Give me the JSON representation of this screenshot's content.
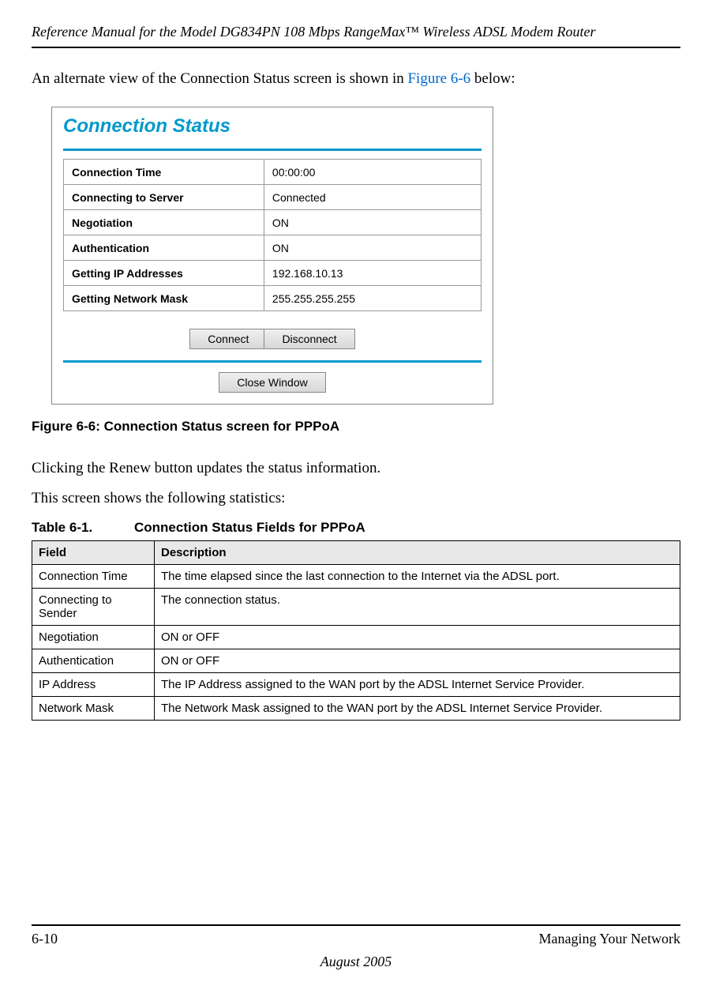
{
  "header": {
    "title": "Reference Manual for the Model DG834PN 108 Mbps RangeMax™ Wireless ADSL Modem Router"
  },
  "intro": {
    "pre": "An alternate view of the Connection Status screen is shown in ",
    "link": "Figure 6-6",
    "post": " below:"
  },
  "screenshot": {
    "title": "Connection Status",
    "rows": [
      {
        "label": "Connection Time",
        "value": "00:00:00"
      },
      {
        "label": "Connecting to Server",
        "value": "Connected"
      },
      {
        "label": "Negotiation",
        "value": "ON"
      },
      {
        "label": "Authentication",
        "value": "ON"
      },
      {
        "label": "Getting IP Addresses",
        "value": "192.168.10.13"
      },
      {
        "label": "Getting Network Mask",
        "value": "255.255.255.255"
      }
    ],
    "buttons": {
      "connect": "Connect",
      "disconnect": "Disconnect",
      "close": "Close Window"
    }
  },
  "figure_caption": "Figure 6-6:  Connection Status screen for PPPoA",
  "para1": "Clicking the Renew button updates the status information.",
  "para2": "This screen shows the following statistics:",
  "table_caption": {
    "num": "Table 6-1.",
    "title": "Connection Status Fields for PPPoA"
  },
  "desc_table": {
    "headers": {
      "field": "Field",
      "desc": "Description"
    },
    "rows": [
      {
        "field": "Connection Time",
        "desc": "The time elapsed since the last connection to the Internet via the ADSL port."
      },
      {
        "field": "Connecting to Sender",
        "desc": "The connection status."
      },
      {
        "field": "Negotiation",
        "desc": "ON or OFF"
      },
      {
        "field": "Authentication",
        "desc": "ON or OFF"
      },
      {
        "field": "IP Address",
        "desc": "The IP Address assigned to the WAN port by the ADSL Internet Service Provider."
      },
      {
        "field": "Network Mask",
        "desc": "The Network Mask assigned to the WAN port by the ADSL Internet Service Provider."
      }
    ]
  },
  "footer": {
    "left": "6-10",
    "right": "Managing Your Network",
    "date": "August 2005"
  }
}
